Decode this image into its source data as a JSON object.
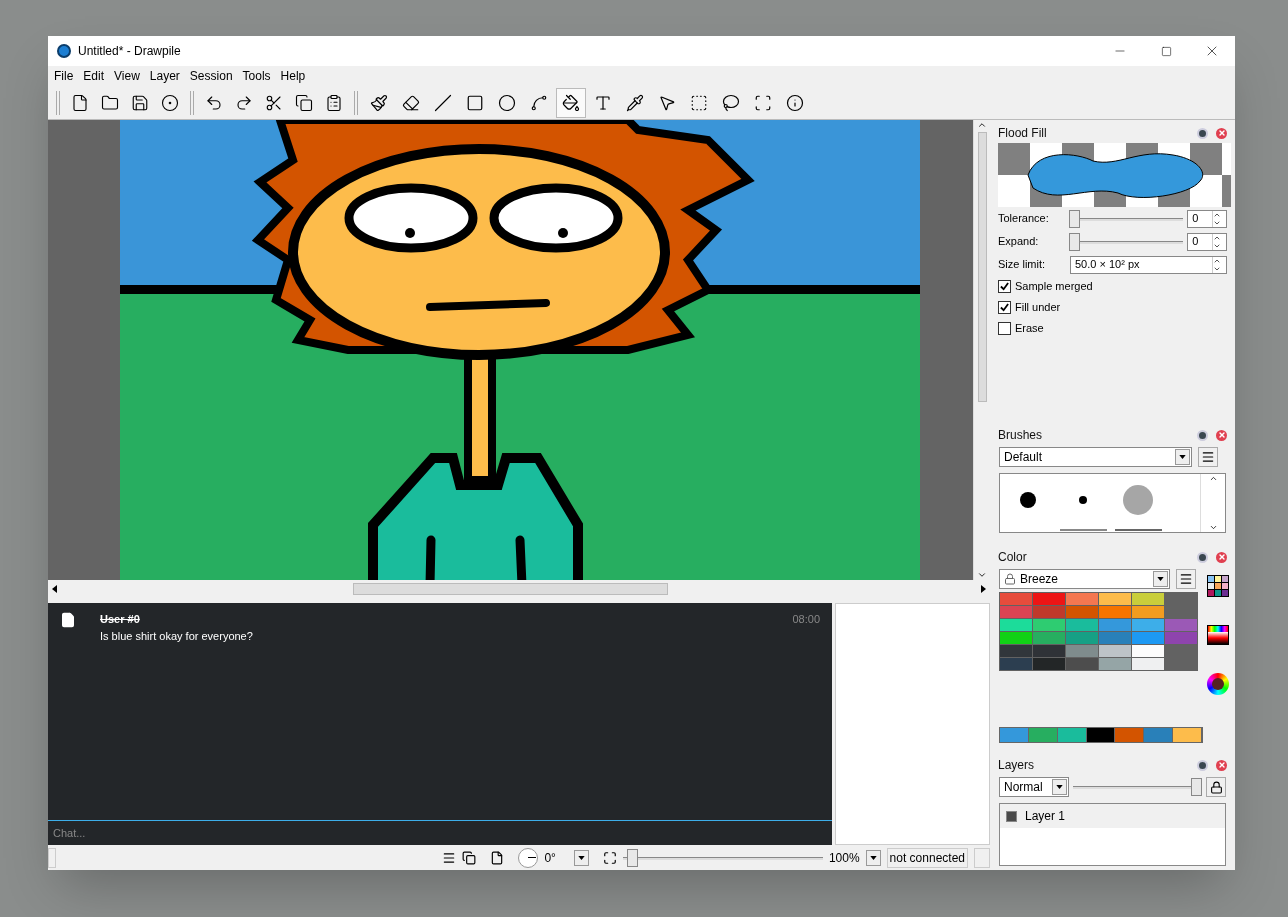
{
  "window": {
    "title": "Untitled* - Drawpile"
  },
  "menu": [
    "File",
    "Edit",
    "View",
    "Layer",
    "Session",
    "Tools",
    "Help"
  ],
  "tools": [
    {
      "kind": "brush",
      "selected": false
    },
    {
      "kind": "eraser",
      "selected": false
    },
    {
      "kind": "line",
      "selected": false
    },
    {
      "kind": "rectangle",
      "selected": false
    },
    {
      "kind": "ellipse",
      "selected": false
    },
    {
      "kind": "curve",
      "selected": false
    },
    {
      "kind": "fill",
      "selected": true
    },
    {
      "kind": "text",
      "selected": false
    },
    {
      "kind": "picker",
      "selected": false
    },
    {
      "kind": "pointer",
      "selected": false
    },
    {
      "kind": "select",
      "selected": false
    },
    {
      "kind": "lasso",
      "selected": false
    },
    {
      "kind": "transform",
      "selected": false
    },
    {
      "kind": "inspector",
      "selected": false
    }
  ],
  "chat": {
    "messages": [
      {
        "user": "User #0",
        "struck": true,
        "text": "Is blue shirt okay for everyone?",
        "time": "08:00"
      }
    ],
    "placeholder": "Chat..."
  },
  "flood_fill": {
    "title": "Flood Fill",
    "settings": [
      {
        "kind": "slider",
        "label": "Tolerance:",
        "level": 0,
        "value": "0"
      },
      {
        "kind": "slider",
        "label": "Expand:",
        "level": 0,
        "value": "0"
      },
      {
        "kind": "spin",
        "label": "Size limit:",
        "value": "50.0 × 10² px"
      }
    ],
    "options": [
      {
        "label": "Sample merged",
        "checked": true
      },
      {
        "label": "Fill under",
        "checked": true
      },
      {
        "label": "Erase",
        "checked": false
      }
    ]
  },
  "brushes": {
    "title": "Brushes",
    "preset_set": "Default"
  },
  "color": {
    "title": "Color",
    "palette": "Breeze",
    "rows": [
      {
        "swatches": [
          {
            "color": "#e74c3c"
          },
          {
            "color": "#ed1515"
          },
          {
            "color": "#f47750"
          },
          {
            "color": "#fdbc4b"
          },
          {
            "color": "#c9ce3b"
          }
        ]
      },
      {
        "swatches": [
          {
            "color": "#da4453"
          },
          {
            "color": "#c0392b"
          },
          {
            "color": "#d35400"
          },
          {
            "color": "#f67400"
          },
          {
            "color": "#f39c1f"
          }
        ]
      },
      {
        "swatches": [
          {
            "color": "#1cdc9a"
          },
          {
            "color": "#2ecc71"
          },
          {
            "color": "#1abc9c"
          },
          {
            "color": "#3498db"
          },
          {
            "color": "#3daee9"
          },
          {
            "color": "#9b59b6"
          }
        ]
      },
      {
        "swatches": [
          {
            "color": "#11d116"
          },
          {
            "color": "#27ae60"
          },
          {
            "color": "#16a085"
          },
          {
            "color": "#2980b9"
          },
          {
            "color": "#1d99f3"
          },
          {
            "color": "#8e44ad"
          }
        ]
      },
      {
        "swatches": [
          {
            "color": "#31363b"
          },
          {
            "color": "#2f3237"
          },
          {
            "color": "#7f8c8d"
          },
          {
            "color": "#bdc3c7"
          },
          {
            "color": "#fcfcfc"
          }
        ]
      },
      {
        "swatches": [
          {
            "color": "#2c3e50"
          },
          {
            "color": "#232627"
          },
          {
            "color": "#4d4d4d"
          },
          {
            "color": "#95a5a6"
          },
          {
            "color": "#eff0f1"
          }
        ]
      }
    ],
    "recent": [
      {
        "color": "#3498db"
      },
      {
        "color": "#27ae60"
      },
      {
        "color": "#1abc9c"
      },
      {
        "color": "#000000"
      },
      {
        "color": "#d35400"
      },
      {
        "color": "#2980b9"
      },
      {
        "color": "#fdbc4b"
      }
    ]
  },
  "layers": {
    "title": "Layers",
    "blend_mode": "Normal",
    "opacity": {
      "level": 1
    },
    "items": [
      {
        "name": "Layer 1",
        "visible": true,
        "selected": true
      }
    ]
  },
  "status_bar": {
    "rotation": "0°",
    "zoom": {
      "level": 0.02,
      "value": "100%"
    },
    "connection": "not connected"
  }
}
